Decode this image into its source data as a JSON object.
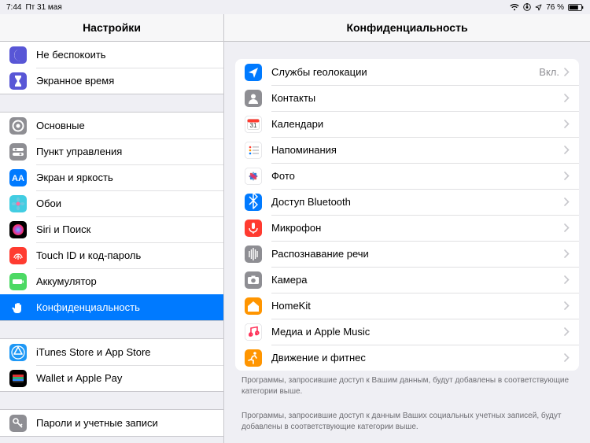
{
  "statusbar": {
    "time": "7:44",
    "date": "Пт 31 мая",
    "battery": "76 %"
  },
  "sidebar": {
    "title": "Настройки",
    "groups": [
      {
        "partialTop": true,
        "items": [
          {
            "id": "dnd",
            "label": "Не беспокоить",
            "icon": "moon",
            "bg": "#5856d6"
          },
          {
            "id": "screen-time",
            "label": "Экранное время",
            "icon": "hourglass",
            "bg": "#5856d6"
          }
        ]
      },
      {
        "items": [
          {
            "id": "general",
            "label": "Основные",
            "icon": "gear",
            "bg": "#8e8e93"
          },
          {
            "id": "control-center",
            "label": "Пункт управления",
            "icon": "switches",
            "bg": "#8e8e93"
          },
          {
            "id": "display",
            "label": "Экран и яркость",
            "icon": "aa",
            "bg": "#007aff"
          },
          {
            "id": "wallpaper",
            "label": "Обои",
            "icon": "flower",
            "bg": "#42cde2"
          },
          {
            "id": "siri",
            "label": "Siri и Поиск",
            "icon": "siri",
            "bg": "#000"
          },
          {
            "id": "touchid",
            "label": "Touch ID и код-пароль",
            "icon": "fingerprint",
            "bg": "#ff3b30"
          },
          {
            "id": "battery",
            "label": "Аккумулятор",
            "icon": "battery",
            "bg": "#4cd964"
          },
          {
            "id": "privacy",
            "label": "Конфиденциальность",
            "icon": "hand",
            "bg": "#007aff",
            "selected": true
          }
        ]
      },
      {
        "items": [
          {
            "id": "itunes",
            "label": "iTunes Store и App Store",
            "icon": "appstore",
            "bg": "#1e98f6"
          },
          {
            "id": "wallet",
            "label": "Wallet и Apple Pay",
            "icon": "wallet",
            "bg": "#000"
          }
        ]
      },
      {
        "items": [
          {
            "id": "passwords",
            "label": "Пароли и учетные записи",
            "icon": "key",
            "bg": "#8e8e93"
          }
        ]
      }
    ]
  },
  "detail": {
    "title": "Конфиденциальность",
    "groups": [
      {
        "items": [
          {
            "id": "location",
            "label": "Службы геолокации",
            "value": "Вкл.",
            "icon": "location",
            "bg": "#007aff"
          },
          {
            "id": "contacts",
            "label": "Контакты",
            "icon": "contacts",
            "bg": "#8e8e93"
          },
          {
            "id": "calendars",
            "label": "Календари",
            "icon": "calendar",
            "bg": "#fff",
            "border": true
          },
          {
            "id": "reminders",
            "label": "Напоминания",
            "icon": "reminders",
            "bg": "#fff",
            "border": true
          },
          {
            "id": "photos",
            "label": "Фото",
            "icon": "photos",
            "bg": "#fff",
            "border": true
          },
          {
            "id": "bluetooth",
            "label": "Доступ Bluetooth",
            "icon": "bluetooth",
            "bg": "#007aff"
          },
          {
            "id": "microphone",
            "label": "Микрофон",
            "icon": "mic",
            "bg": "#ff3b30"
          },
          {
            "id": "speech",
            "label": "Распознавание речи",
            "icon": "speech",
            "bg": "#8e8e93"
          },
          {
            "id": "camera",
            "label": "Камера",
            "icon": "camera",
            "bg": "#8e8e93"
          },
          {
            "id": "homekit",
            "label": "HomeKit",
            "icon": "home",
            "bg": "#ff9500"
          },
          {
            "id": "media",
            "label": "Медиа и Apple Music",
            "icon": "music",
            "bg": "#fff",
            "border": true
          },
          {
            "id": "motion",
            "label": "Движение и фитнес",
            "icon": "motion",
            "bg": "#ff9500"
          }
        ],
        "footer": "Программы, запросившие доступ к Вашим данным, будут добавлены в соответствующие категории выше."
      },
      {
        "footerOnly": true,
        "footer": "Программы, запросившие доступ к данным Ваших социальных учетных записей, будут добавлены в соответствующие категории выше."
      }
    ]
  }
}
